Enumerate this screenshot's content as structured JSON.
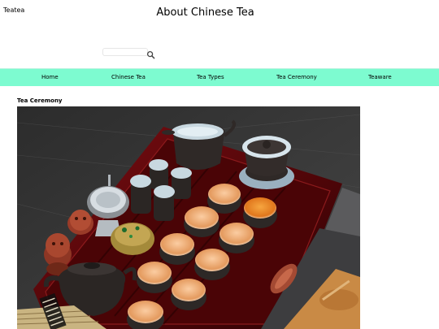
{
  "header": {
    "logo": "Teatea",
    "title": "About Chinese Tea"
  },
  "search": {
    "placeholder": "",
    "value": "",
    "icon": "search-icon"
  },
  "nav": {
    "background": "#7dfbd0",
    "items": [
      {
        "label": "Home"
      },
      {
        "label": "Chinese Tea"
      },
      {
        "label": "Tea Types"
      },
      {
        "label": "Tea Ceremony"
      },
      {
        "label": "Teaware"
      }
    ]
  },
  "main": {
    "section_title": "Tea Ceremony"
  }
}
